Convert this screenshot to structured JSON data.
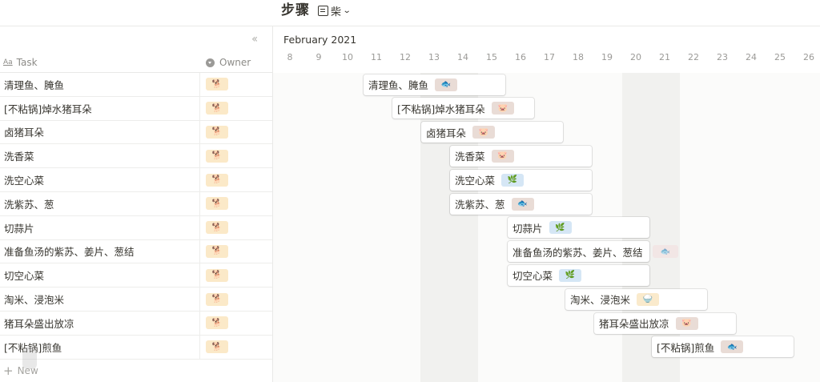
{
  "header": {
    "title": "步骤",
    "view_label": "柴"
  },
  "table": {
    "task_col": "Task",
    "task_col_icon": "Aa",
    "owner_col": "Owner",
    "new_label": "New",
    "rows": [
      {
        "task": "清理鱼、腌鱼",
        "owner": "🐕"
      },
      {
        "task": "[不粘锅]焯水猪耳朵",
        "owner": "🐕"
      },
      {
        "task": "卤猪耳朵",
        "owner": "🐕"
      },
      {
        "task": "洗香菜",
        "owner": "🐕"
      },
      {
        "task": "洗空心菜",
        "owner": "🐕"
      },
      {
        "task": "洗紫苏、葱",
        "owner": "🐕"
      },
      {
        "task": "切蒜片",
        "owner": "🐕"
      },
      {
        "task": "准备鱼汤的紫苏、姜片、葱结",
        "owner": "🐕"
      },
      {
        "task": "切空心菜",
        "owner": "🐕"
      },
      {
        "task": "淘米、浸泡米",
        "owner": "🐕"
      },
      {
        "task": "猪耳朵盛出放凉",
        "owner": "🐕"
      },
      {
        "task": "[不粘锅]煎鱼",
        "owner": "🐕"
      }
    ]
  },
  "timeline": {
    "month": "February 2021",
    "days": [
      "8",
      "9",
      "10",
      "11",
      "12",
      "13",
      "14",
      "15",
      "16",
      "17",
      "18",
      "19",
      "20",
      "21",
      "22",
      "23",
      "24",
      "25",
      "26"
    ],
    "cards": [
      {
        "label": "清理鱼、腌鱼",
        "tag": "🐟",
        "tag_color": "#e9dcd6"
      },
      {
        "label": "[不粘锅]焯水猪耳朵",
        "tag": "🐷",
        "tag_color": "#e9dcd6"
      },
      {
        "label": "卤猪耳朵",
        "tag": "🐷",
        "tag_color": "#e9dcd6"
      },
      {
        "label": "洗香菜",
        "tag": "🐷",
        "tag_color": "#e9dcd6"
      },
      {
        "label": "洗空心菜",
        "tag": "🌿",
        "tag_color": "#d5e6f5"
      },
      {
        "label": "洗紫苏、葱",
        "tag": "🐟",
        "tag_color": "#e9dcd6"
      },
      {
        "label": "切蒜片",
        "tag": "🌿",
        "tag_color": "#d5e6f5"
      },
      {
        "label": "准备鱼汤的紫苏、姜片、葱结",
        "tag": "🐟",
        "tag_color": "#f3dede"
      },
      {
        "label": "切空心菜",
        "tag": "🌿",
        "tag_color": "#d5e6f5"
      },
      {
        "label": "淘米、浸泡米",
        "tag": "🍚",
        "tag_color": "#faeacc"
      },
      {
        "label": "猪耳朵盛出放凉",
        "tag": "🐷",
        "tag_color": "#e9dcd6"
      },
      {
        "label": "[不粘锅]煎鱼",
        "tag": "🐟",
        "tag_color": "#e9dcd6"
      }
    ]
  },
  "colors": {
    "owner_chip": "#fbe9c8",
    "weekend": "#f1f1ef",
    "grid_bg": "#fbfbfa"
  }
}
